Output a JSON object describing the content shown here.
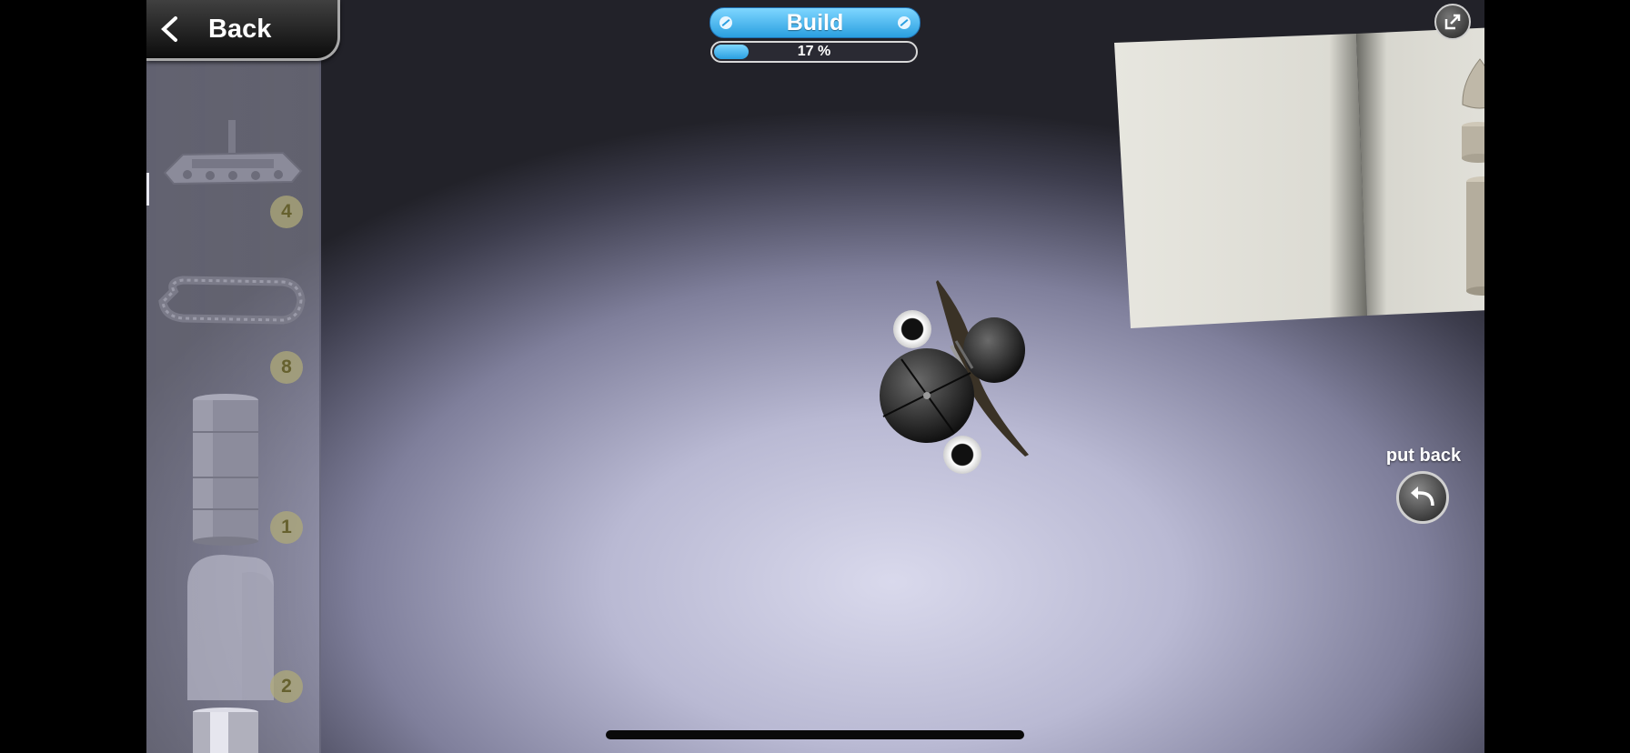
{
  "header": {
    "back_label": "Back",
    "title": "Build",
    "progress_percent": 17,
    "progress_text": "17 %"
  },
  "parts": [
    {
      "name": "tank-tracks-assembly",
      "count": "4"
    },
    {
      "name": "track-belt",
      "count": "8"
    },
    {
      "name": "cylinder-tube",
      "count": "1"
    },
    {
      "name": "half-shell",
      "count": "2"
    }
  ],
  "put_back": {
    "label": "put back"
  },
  "icons": {
    "back": "chevron-left-icon",
    "expand": "expand-arrow-icon",
    "put_back": "undo-arrow-icon"
  },
  "colors": {
    "accent": "#2a9fe0",
    "badge": "#afaa78",
    "book_page": "#e7e6df"
  }
}
